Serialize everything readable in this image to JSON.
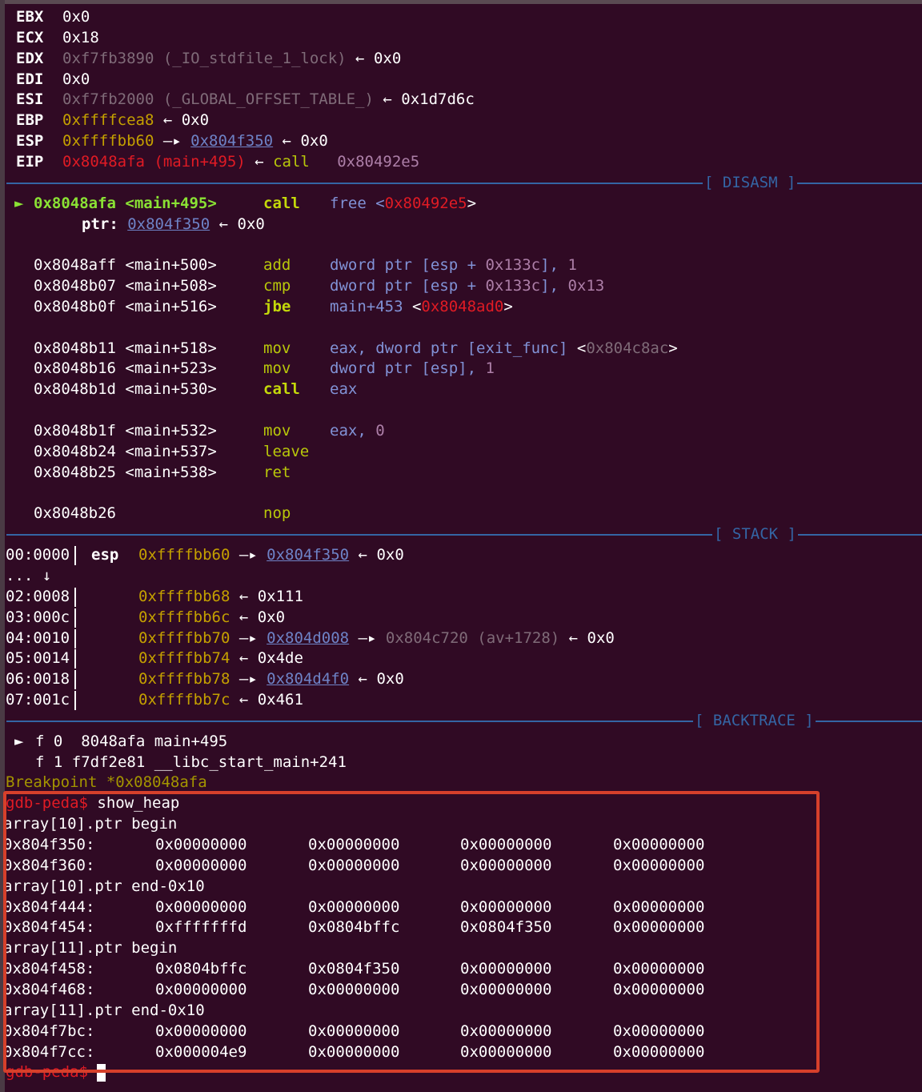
{
  "registers": [
    {
      "name": "EBX",
      "parts": [
        {
          "t": "0x0",
          "c": "white"
        }
      ]
    },
    {
      "name": "ECX",
      "parts": [
        {
          "t": "0x18",
          "c": "white"
        }
      ]
    },
    {
      "name": "EDX",
      "parts": [
        {
          "t": "0xf7fb3890 (_IO_stdfile_1_lock)",
          "c": "grey"
        },
        {
          "t": " ← ",
          "c": "white"
        },
        {
          "t": "0x0",
          "c": "white"
        }
      ]
    },
    {
      "name": "EDI",
      "parts": [
        {
          "t": "0x0",
          "c": "white"
        }
      ]
    },
    {
      "name": "ESI",
      "parts": [
        {
          "t": "0xf7fb2000 (_GLOBAL_OFFSET_TABLE_)",
          "c": "grey"
        },
        {
          "t": " ← ",
          "c": "white"
        },
        {
          "t": "0x1d7d6c",
          "c": "white"
        }
      ]
    },
    {
      "name": "EBP",
      "parts": [
        {
          "t": "0xffffcea8",
          "c": "yellow"
        },
        {
          "t": " ← ",
          "c": "white"
        },
        {
          "t": "0x0",
          "c": "white"
        }
      ]
    },
    {
      "name": "ESP",
      "parts": [
        {
          "t": "0xffffbb60",
          "c": "yellow"
        },
        {
          "t": " —▸ ",
          "c": "white"
        },
        {
          "t": "0x804f350",
          "c": "link"
        },
        {
          "t": " ← ",
          "c": "white"
        },
        {
          "t": "0x0",
          "c": "white"
        }
      ]
    },
    {
      "name": "EIP",
      "parts": [
        {
          "t": "0x8048afa (main+495)",
          "c": "red"
        },
        {
          "t": " ← ",
          "c": "white"
        },
        {
          "t": "call",
          "c": "ygreen"
        },
        {
          "t": "   ",
          "c": "white"
        },
        {
          "t": "0x80492e5",
          "c": "purple"
        }
      ]
    }
  ],
  "sections": {
    "disasm": "[ DISASM ]",
    "stack": "[ STACK ]",
    "backtrace": "[ BACKTRACE ]"
  },
  "disasm": {
    "current": {
      "marker": "►",
      "addr": "0x8048afa <main+495>",
      "mnem": "call",
      "op_a": "free <",
      "op_b": "0x80492e5",
      "op_c": ">"
    },
    "ptr_line": {
      "label": "ptr:",
      "addr": "0x804f350",
      "arrow": "←",
      "value": "0x0"
    },
    "rows": [
      {
        "addr": "0x8048aff <main+500>",
        "mnem": "add",
        "mnem_c": "ygreen",
        "ops": [
          {
            "t": "dword ptr [esp + ",
            "c": "blue"
          },
          {
            "t": "0x133c",
            "c": "purple"
          },
          {
            "t": "], ",
            "c": "blue"
          },
          {
            "t": "1",
            "c": "purple"
          }
        ]
      },
      {
        "addr": "0x8048b07 <main+508>",
        "mnem": "cmp",
        "mnem_c": "ygreen",
        "ops": [
          {
            "t": "dword ptr [esp + ",
            "c": "blue"
          },
          {
            "t": "0x133c",
            "c": "purple"
          },
          {
            "t": "], ",
            "c": "blue"
          },
          {
            "t": "0x13",
            "c": "purple"
          }
        ]
      },
      {
        "addr": "0x8048b0f <main+516>",
        "mnem": "jbe",
        "mnem_c": "lime",
        "ops": [
          {
            "t": "main+453",
            "c": "blue"
          },
          {
            "t": " <",
            "c": "white"
          },
          {
            "t": "0x8048ad0",
            "c": "red"
          },
          {
            "t": ">",
            "c": "white"
          }
        ]
      },
      {
        "addr": "0x8048b11 <main+518>",
        "mnem": "mov",
        "mnem_c": "ygreen",
        "ops": [
          {
            "t": "eax, dword ptr [exit_func] ",
            "c": "blue"
          },
          {
            "t": "<",
            "c": "white"
          },
          {
            "t": "0x804c8ac",
            "c": "grey"
          },
          {
            "t": ">",
            "c": "white"
          }
        ]
      },
      {
        "addr": "0x8048b16 <main+523>",
        "mnem": "mov",
        "mnem_c": "ygreen",
        "ops": [
          {
            "t": "dword ptr [esp], ",
            "c": "blue"
          },
          {
            "t": "1",
            "c": "purple"
          }
        ]
      },
      {
        "addr": "0x8048b1d <main+530>",
        "mnem": "call",
        "mnem_c": "lime",
        "ops": [
          {
            "t": "eax",
            "c": "blue"
          }
        ]
      },
      {
        "addr": "0x8048b1f <main+532>",
        "mnem": "mov",
        "mnem_c": "ygreen",
        "ops": [
          {
            "t": "eax, ",
            "c": "blue"
          },
          {
            "t": "0",
            "c": "purple"
          }
        ]
      },
      {
        "addr": "0x8048b24 <main+537>",
        "mnem": "leave",
        "mnem_c": "ygreen",
        "ops": []
      },
      {
        "addr": "0x8048b25 <main+538>",
        "mnem": "ret",
        "mnem_c": "ygreen",
        "ops": []
      },
      {
        "addr": "0x8048b26",
        "mnem": "nop",
        "mnem_c": "ygreen",
        "ops": []
      }
    ]
  },
  "stack": [
    {
      "off": "00:0000",
      "reg": "esp",
      "parts": [
        {
          "t": "0xffffbb60",
          "c": "yellow"
        },
        {
          "t": " —▸ ",
          "c": "white"
        },
        {
          "t": "0x804f350",
          "c": "link"
        },
        {
          "t": " ← ",
          "c": "white"
        },
        {
          "t": "0x0",
          "c": "white"
        }
      ]
    },
    {
      "off": "... ↓",
      "reg": "",
      "parts": []
    },
    {
      "off": "02:0008",
      "reg": "",
      "parts": [
        {
          "t": "0xffffbb68",
          "c": "yellow"
        },
        {
          "t": " ← ",
          "c": "white"
        },
        {
          "t": "0x111",
          "c": "white"
        }
      ]
    },
    {
      "off": "03:000c",
      "reg": "",
      "parts": [
        {
          "t": "0xffffbb6c",
          "c": "yellow"
        },
        {
          "t": " ← ",
          "c": "white"
        },
        {
          "t": "0x0",
          "c": "white"
        }
      ]
    },
    {
      "off": "04:0010",
      "reg": "",
      "parts": [
        {
          "t": "0xffffbb70",
          "c": "yellow"
        },
        {
          "t": " —▸ ",
          "c": "white"
        },
        {
          "t": "0x804d008",
          "c": "link"
        },
        {
          "t": " —▸ ",
          "c": "white"
        },
        {
          "t": "0x804c720 (av+1728)",
          "c": "grey"
        },
        {
          "t": " ← ",
          "c": "white"
        },
        {
          "t": "0x0",
          "c": "white"
        }
      ]
    },
    {
      "off": "05:0014",
      "reg": "",
      "parts": [
        {
          "t": "0xffffbb74",
          "c": "yellow"
        },
        {
          "t": " ← ",
          "c": "white"
        },
        {
          "t": "0x4de",
          "c": "white"
        }
      ]
    },
    {
      "off": "06:0018",
      "reg": "",
      "parts": [
        {
          "t": "0xffffbb78",
          "c": "yellow"
        },
        {
          "t": " —▸ ",
          "c": "white"
        },
        {
          "t": "0x804d4f0",
          "c": "link"
        },
        {
          "t": " ← ",
          "c": "white"
        },
        {
          "t": "0x0",
          "c": "white"
        }
      ]
    },
    {
      "off": "07:001c",
      "reg": "",
      "parts": [
        {
          "t": "0xffffbb7c",
          "c": "yellow"
        },
        {
          "t": " ← ",
          "c": "white"
        },
        {
          "t": "0x461",
          "c": "white"
        }
      ]
    }
  ],
  "backtrace": [
    {
      "marker": "►",
      "text": "f 0  8048afa main+495"
    },
    {
      "marker": "",
      "text": "f 1 f7df2e81 __libc_start_main+241"
    }
  ],
  "breakpoint_line": "Breakpoint *0x08048afa",
  "prompt": "gdb-peda$",
  "command": "show_heap",
  "heap_output": [
    {
      "type": "label",
      "text": "array[10].ptr begin"
    },
    {
      "type": "row",
      "addr": "0x804f350:",
      "vals": [
        "0x00000000",
        "0x00000000",
        "0x00000000",
        "0x00000000"
      ]
    },
    {
      "type": "row",
      "addr": "0x804f360:",
      "vals": [
        "0x00000000",
        "0x00000000",
        "0x00000000",
        "0x00000000"
      ]
    },
    {
      "type": "label",
      "text": "array[10].ptr end-0x10"
    },
    {
      "type": "row",
      "addr": "0x804f444:",
      "vals": [
        "0x00000000",
        "0x00000000",
        "0x00000000",
        "0x00000000"
      ]
    },
    {
      "type": "row",
      "addr": "0x804f454:",
      "vals": [
        "0xfffffffd",
        "0x0804bffc",
        "0x0804f350",
        "0x00000000"
      ]
    },
    {
      "type": "label",
      "text": "array[11].ptr begin"
    },
    {
      "type": "row",
      "addr": "0x804f458:",
      "vals": [
        "0x0804bffc",
        "0x0804f350",
        "0x00000000",
        "0x00000000"
      ]
    },
    {
      "type": "row",
      "addr": "0x804f468:",
      "vals": [
        "0x00000000",
        "0x00000000",
        "0x00000000",
        "0x00000000"
      ]
    },
    {
      "type": "label",
      "text": "array[11].ptr end-0x10"
    },
    {
      "type": "row",
      "addr": "0x804f7bc:",
      "vals": [
        "0x00000000",
        "0x00000000",
        "0x00000000",
        "0x00000000"
      ]
    },
    {
      "type": "row",
      "addr": "0x804f7cc:",
      "vals": [
        "0x000004e9",
        "0x00000000",
        "0x00000000",
        "0x00000000"
      ]
    }
  ],
  "final_prompt": "gdb-peda$"
}
